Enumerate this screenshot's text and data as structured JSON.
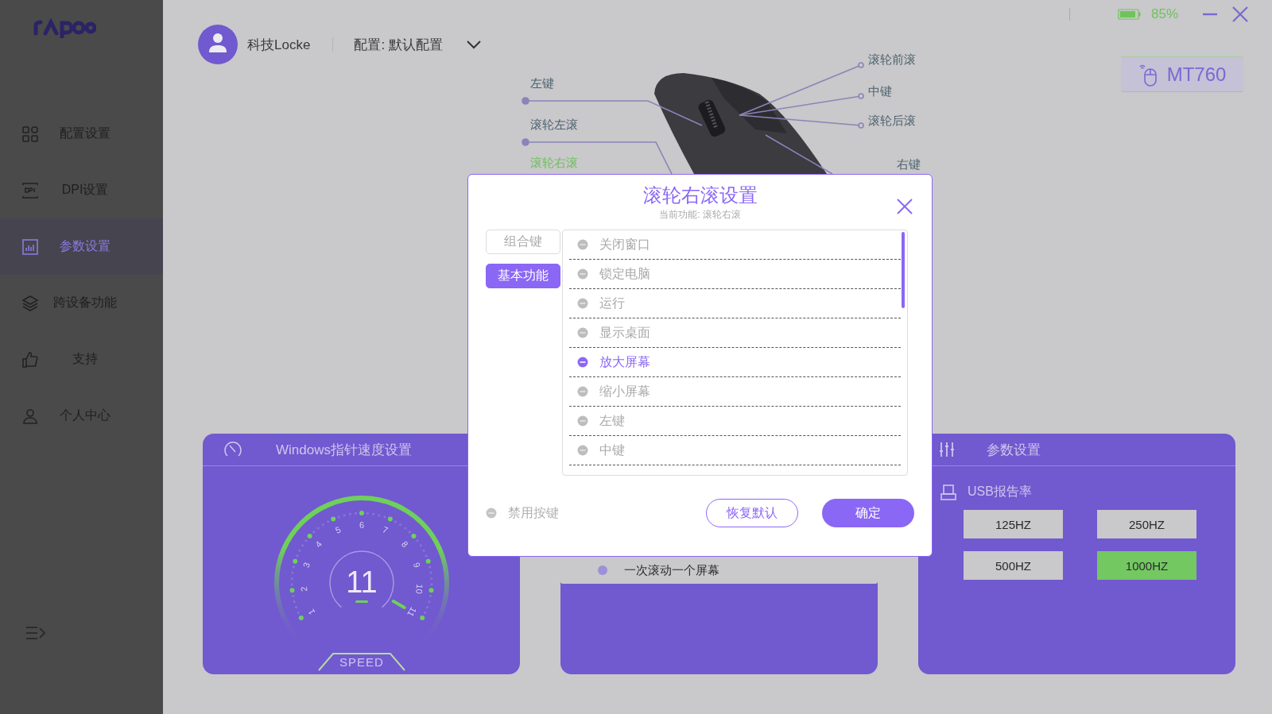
{
  "sidebar": {
    "items": [
      {
        "label": "配置设置",
        "selected": false
      },
      {
        "label": "DPI设置",
        "selected": false
      },
      {
        "label": "参数设置",
        "selected": true
      },
      {
        "label": "跨设备功能",
        "selected": false
      },
      {
        "label": "支持",
        "selected": false
      },
      {
        "label": "个人中心",
        "selected": false
      }
    ]
  },
  "header": {
    "user": "科技Locke",
    "profile": "配置: 默认配置"
  },
  "status": {
    "battery": "85%"
  },
  "device": {
    "model": "MT760"
  },
  "mouse_diagram": {
    "labels": [
      {
        "text": "左键",
        "selected": false
      },
      {
        "text": "滚轮左滚",
        "selected": false
      },
      {
        "text": "滚轮右滚",
        "selected": true
      },
      {
        "text": "滚轮前滚",
        "selected": false
      },
      {
        "text": "中键",
        "selected": false
      },
      {
        "text": "滚轮后滚",
        "selected": false
      },
      {
        "text": "右键",
        "selected": false
      }
    ]
  },
  "cards": [
    {
      "kind": "speed",
      "title": "Windows指针速度设置",
      "gauge": {
        "value": "11",
        "ticks": [
          "1",
          "2",
          "3",
          "4",
          "5",
          "6",
          "7",
          "8",
          "9",
          "10",
          "11"
        ],
        "caption": "SPEED"
      }
    },
    {
      "kind": "scroll",
      "options": [
        {
          "label": "一次滚动一个屏幕",
          "selected": false
        }
      ]
    },
    {
      "kind": "params",
      "title": "参数设置",
      "section": "USB报告率",
      "rates": [
        {
          "label": "125HZ",
          "selected": false
        },
        {
          "label": "250HZ",
          "selected": false
        },
        {
          "label": "500HZ",
          "selected": false
        },
        {
          "label": "1000HZ",
          "selected": true
        }
      ]
    }
  ],
  "dialog": {
    "title": "滚轮右滚设置",
    "subtitle": "当前功能: 滚轮右滚",
    "tabs": [
      {
        "label": "组合键",
        "selected": false
      },
      {
        "label": "基本功能",
        "selected": true
      }
    ],
    "options": [
      {
        "label": "关闭窗口",
        "selected": false
      },
      {
        "label": "锁定电脑",
        "selected": false
      },
      {
        "label": "运行",
        "selected": false
      },
      {
        "label": "显示桌面",
        "selected": false
      },
      {
        "label": "放大屏幕",
        "selected": true
      },
      {
        "label": "缩小屏幕",
        "selected": false
      },
      {
        "label": "左键",
        "selected": false
      },
      {
        "label": "中键",
        "selected": false
      }
    ],
    "disable_key": {
      "label": "禁用按键",
      "checked": false
    },
    "buttons": [
      {
        "label": "恢复默认",
        "kind": "secondary"
      },
      {
        "label": "确定",
        "kind": "primary"
      }
    ]
  }
}
